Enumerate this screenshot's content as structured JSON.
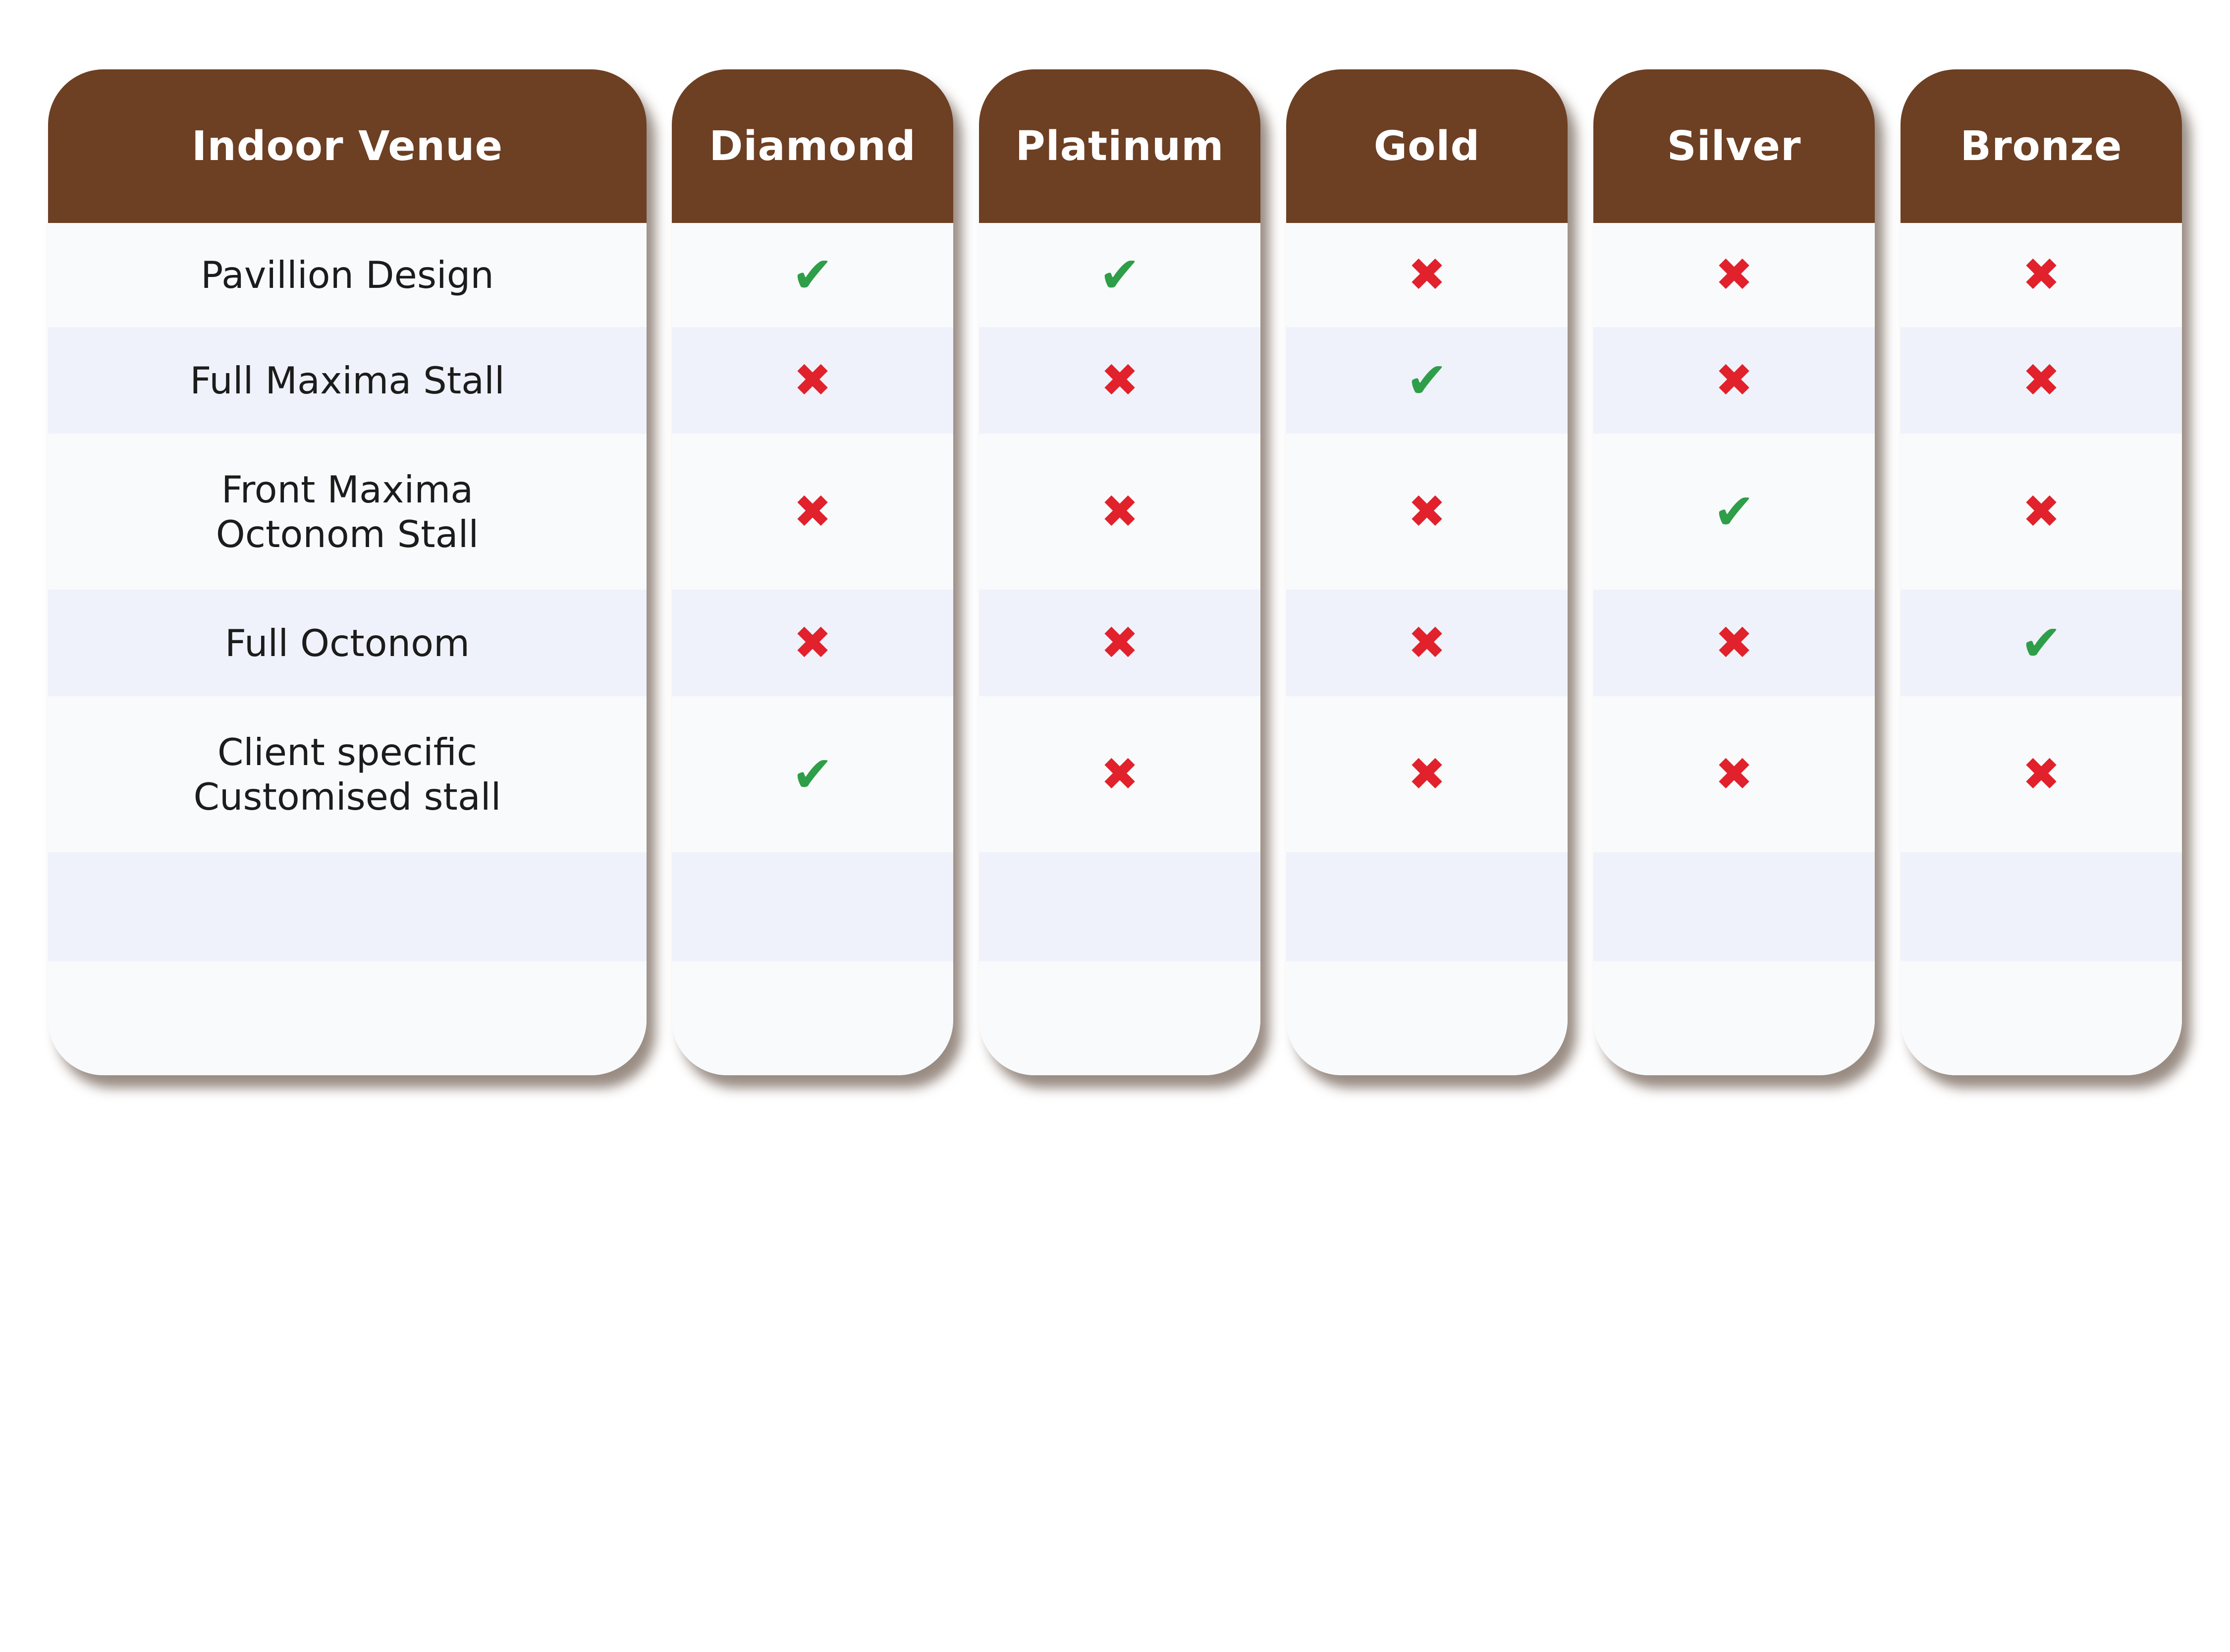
{
  "colors": {
    "header": "#6d3f23",
    "check": "#2e9e48",
    "cross": "#e1212b",
    "row_alt": "#eff2fa",
    "row_plain": "#f9fafb"
  },
  "icons": {
    "included": "check-icon",
    "excluded": "cross-icon"
  },
  "table": {
    "first_header": "Indoor Venue",
    "tiers": [
      "Diamond",
      "Platinum",
      "Gold",
      "Silver",
      "Bronze"
    ],
    "features": [
      "Pavillion Design",
      "Full Maxima Stall",
      "Front Maxima\nOctonom Stall",
      "Full Octonom",
      "Client specific\nCustomised stall"
    ],
    "availability": {
      "Diamond": [
        true,
        false,
        false,
        false,
        true
      ],
      "Platinum": [
        true,
        false,
        false,
        false,
        false
      ],
      "Gold": [
        false,
        true,
        false,
        false,
        false
      ],
      "Silver": [
        false,
        false,
        true,
        false,
        false
      ],
      "Bronze": [
        false,
        false,
        false,
        true,
        false
      ]
    }
  }
}
